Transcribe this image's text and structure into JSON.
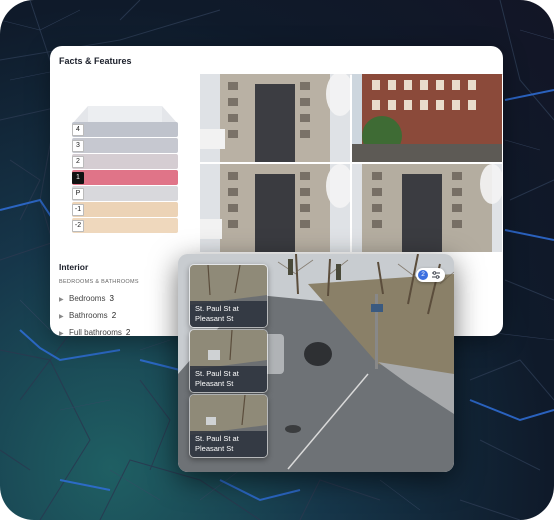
{
  "facts_card": {
    "title": "Facts & Features",
    "floors": [
      {
        "label": "4",
        "color": "#bfc3cc",
        "active": false
      },
      {
        "label": "3",
        "color": "#c6c8d0",
        "active": false
      },
      {
        "label": "2",
        "color": "#d5cdd2",
        "active": false
      },
      {
        "label": "1",
        "color": "#e07488",
        "active": true
      },
      {
        "label": "P",
        "color": "#d8d8dc",
        "active": false
      },
      {
        "label": "-1",
        "color": "#ecd3b6",
        "active": false
      },
      {
        "label": "-2",
        "color": "#efd8bd",
        "active": false
      }
    ],
    "photos": [
      {
        "name": "building-photo-1"
      },
      {
        "name": "building-photo-2"
      },
      {
        "name": "building-photo-3"
      },
      {
        "name": "building-photo-4"
      }
    ],
    "interior": {
      "title": "Interior",
      "subtitle": "BEDROOMS & BATHROOMS",
      "rows": [
        {
          "label": "Bedrooms",
          "value": "3"
        },
        {
          "label": "Bathrooms",
          "value": "2"
        },
        {
          "label": "Full bathrooms",
          "value": "2"
        }
      ]
    }
  },
  "camera_panel": {
    "badge_count": "2",
    "badge_icon": "filter-icon",
    "thumbnails": [
      {
        "label_line1": "St. Paul St at",
        "label_line2": "Pleasant St"
      },
      {
        "label_line1": "St. Paul St at",
        "label_line2": "Pleasant St"
      },
      {
        "label_line1": "St. Paul St at",
        "label_line2": "Pleasant St"
      }
    ]
  },
  "colors": {
    "background_dark": "#0f1a2a",
    "map_road": "#2f6fd8",
    "accent_teal": "#1f5f63",
    "active_floor": "#e07488",
    "badge_blue": "#3b6fe0"
  }
}
